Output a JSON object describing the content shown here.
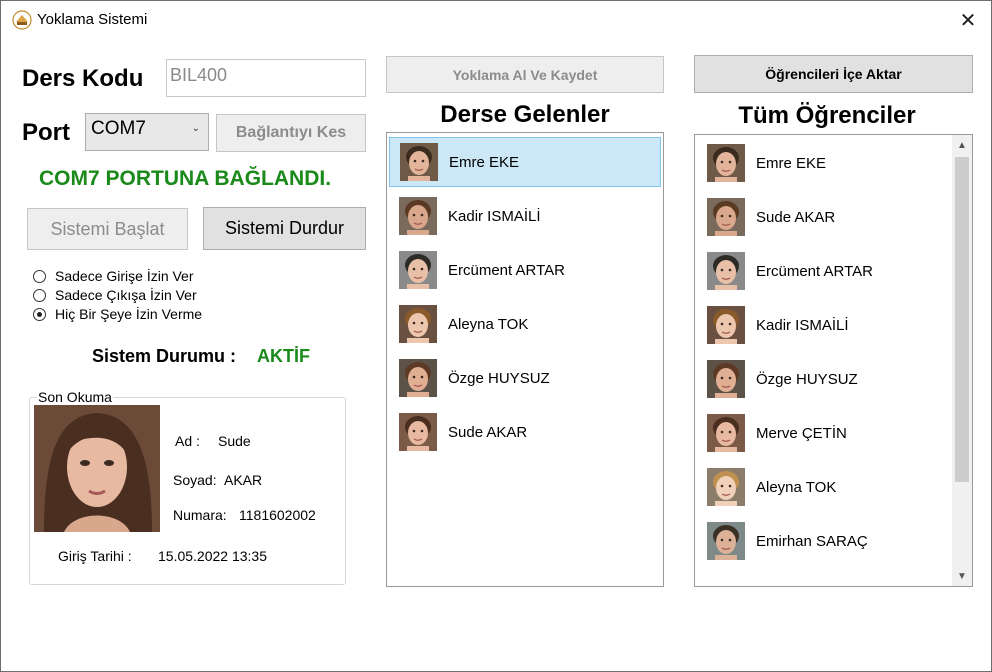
{
  "window": {
    "title": "Yoklama Sistemi",
    "close_glyph": "✕"
  },
  "form": {
    "ders_kodu_label": "Ders Kodu",
    "ders_kodu_value": "BIL400",
    "port_label": "Port",
    "port_value": "COM7",
    "disconnect_button": "Bağlantıyı Kes",
    "connection_status": "COM7 PORTUNA BAĞLANDI.",
    "start_button": "Sistemi Başlat",
    "stop_button": "Sistemi Durdur",
    "radio_options": [
      {
        "label": "Sadece Girişe İzin Ver",
        "checked": false
      },
      {
        "label": "Sadece Çıkışa İzin Ver",
        "checked": false
      },
      {
        "label": "Hiç Bir Şeye İzin Verme",
        "checked": true
      }
    ],
    "system_status_label": "Sistem Durumu :",
    "system_status_value": "AKTİF"
  },
  "last_read": {
    "group_title": "Son Okuma",
    "ad_label": "Ad :",
    "ad_value": "Sude",
    "soyad_label": "Soyad:",
    "soyad_value": "AKAR",
    "numara_label": "Numara:",
    "numara_value": "1181602002",
    "giris_label": "Giriş Tarihi :",
    "giris_value": "15.05.2022 13:35"
  },
  "attendance": {
    "save_button": "Yoklama Al Ve Kaydet",
    "title": "Derse Gelenler",
    "students": [
      "Emre EKE",
      "Kadir ISMAİLİ",
      "Ercüment ARTAR",
      "Aleyna TOK",
      "Özge HUYSUZ",
      "Sude AKAR"
    ],
    "selected_index": 0
  },
  "all_students": {
    "import_button": "Öğrencileri İçe Aktar",
    "title": "Tüm Öğrenciler",
    "students": [
      "Emre EKE",
      "Sude AKAR",
      "Ercüment ARTAR",
      "Kadir ISMAİLİ",
      "Özge HUYSUZ",
      "Merve ÇETİN",
      "Aleyna TOK",
      "Emirhan SARAÇ"
    ]
  },
  "colors": {
    "status_green": "#1a8a1a",
    "selection": "#cce8f7",
    "selection_border": "#7fc4ea"
  }
}
